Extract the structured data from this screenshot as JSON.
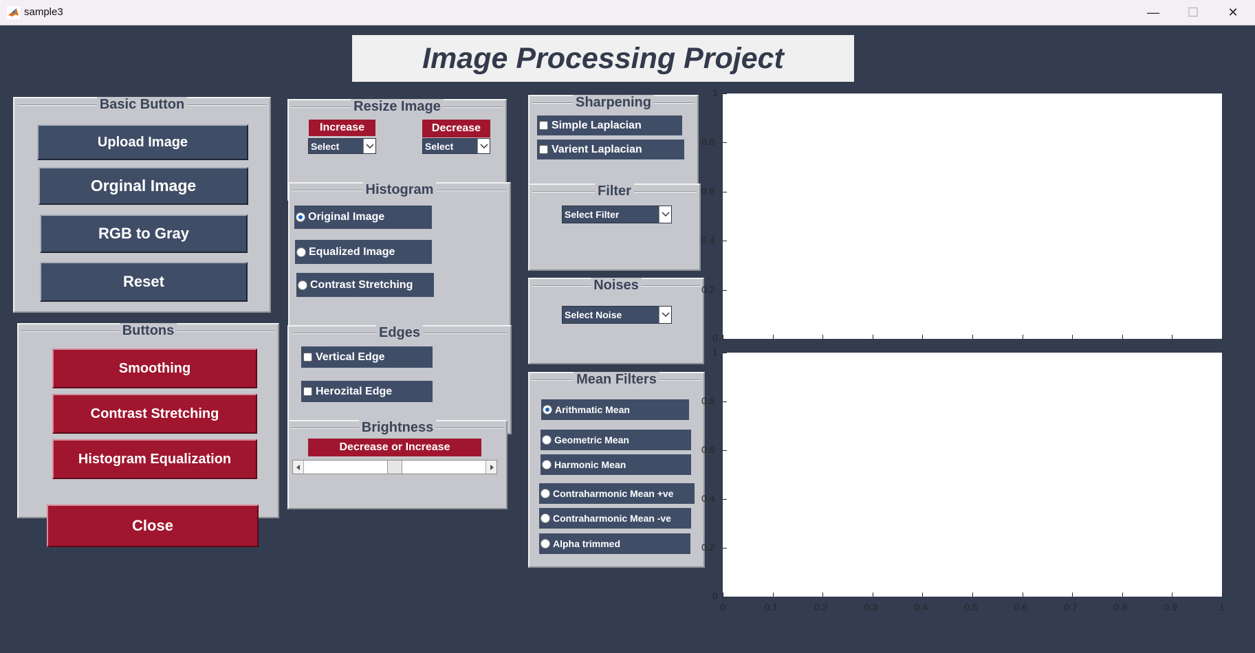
{
  "window": {
    "title": "sample3",
    "minimize_glyph": "—",
    "maximize_glyph": "☐",
    "close_glyph": "✕",
    "icon": "matlab-icon"
  },
  "header": {
    "title": "Image Processing Project"
  },
  "basic_button": {
    "legend": "Basic Button",
    "upload": "Upload Image",
    "original": "Orginal Image",
    "rgb_gray": "RGB to Gray",
    "reset": "Reset"
  },
  "buttons_panel": {
    "legend": "Buttons",
    "smoothing": "Smoothing",
    "contrast": "Contrast Stretching",
    "histeq": "Histogram Equalization"
  },
  "close_label": "Close",
  "resize": {
    "legend": "Resize Image",
    "increase": "Increase",
    "decrease": "Decrease",
    "increase_select": "Select",
    "decrease_select": "Select"
  },
  "histogram": {
    "legend": "Histogram",
    "options": [
      "Original Image",
      "Equalized Image",
      "Contrast Stretching"
    ],
    "selected": 0
  },
  "edges": {
    "legend": "Edges",
    "vertical": "Vertical Edge",
    "horizontal": "Herozital Edge"
  },
  "brightness": {
    "legend": "Brightness",
    "label": "Decrease or Increase",
    "slider_value": 0.5
  },
  "sharpening": {
    "legend": "Sharpening",
    "simple": "Simple Laplacian",
    "varient": "Varient Laplacian"
  },
  "filter": {
    "legend": "Filter",
    "select": "Select Filter"
  },
  "noises": {
    "legend": "Noises",
    "select": "Select Noise"
  },
  "mean_filters": {
    "legend": "Mean Filters",
    "options": [
      "Arithmatic Mean",
      "Geometric Mean",
      "Harmonic Mean",
      "Contraharmonic Mean +ve",
      "Contraharmonic Mean -ve",
      "Alpha trimmed"
    ],
    "selected": 0
  },
  "axes": {
    "x_ticks": [
      "0",
      "0.1",
      "0.2",
      "0.3",
      "0.4",
      "0.5",
      "0.6",
      "0.7",
      "0.8",
      "0.9",
      "1"
    ],
    "y_ticks": [
      "0",
      "0.2",
      "0.4",
      "0.6",
      "0.8",
      "1"
    ]
  }
}
